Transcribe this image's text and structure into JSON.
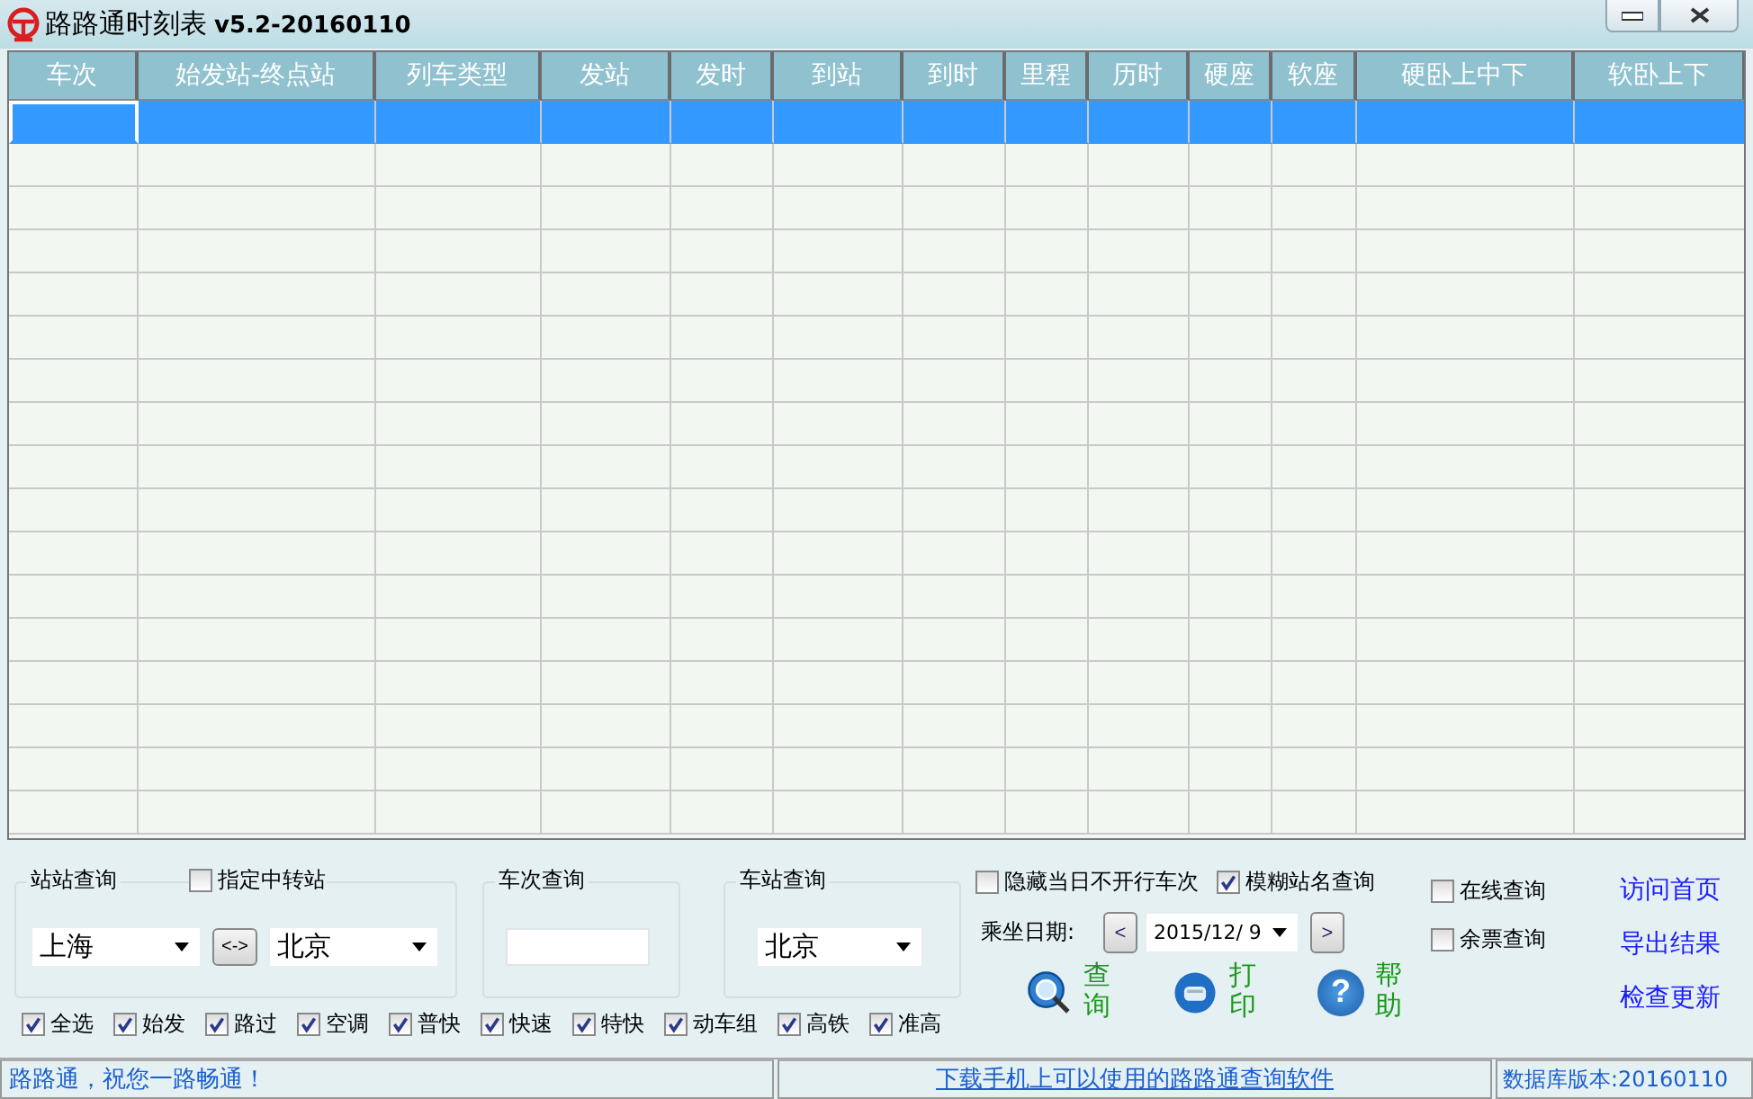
{
  "window": {
    "title": "路路通时刻表",
    "version": "v5.2-20160110"
  },
  "table": {
    "columns": [
      "车次",
      "始发站-终点站",
      "列车类型",
      "发站",
      "发时",
      "到站",
      "到时",
      "里程",
      "历时",
      "硬座",
      "软座",
      "硬卧上中下",
      "软卧上下"
    ],
    "rows": [
      {
        "selected": true
      },
      {
        "selected": false
      },
      {
        "selected": false
      },
      {
        "selected": false
      },
      {
        "selected": false
      },
      {
        "selected": false
      },
      {
        "selected": false
      },
      {
        "selected": false
      },
      {
        "selected": false
      },
      {
        "selected": false
      },
      {
        "selected": false
      },
      {
        "selected": false
      },
      {
        "selected": false
      },
      {
        "selected": false
      },
      {
        "selected": false
      },
      {
        "selected": false
      },
      {
        "selected": false
      }
    ]
  },
  "station_query": {
    "label": "站站查询",
    "transfer": {
      "label": "指定中转站",
      "checked": false
    },
    "from": "上海",
    "swap": "<->",
    "to": "北京"
  },
  "train_query": {
    "label": "车次查询"
  },
  "station_lookup": {
    "label": "车站查询",
    "value": "北京"
  },
  "filters": [
    {
      "label": "全选",
      "checked": true
    },
    {
      "label": "始发",
      "checked": true
    },
    {
      "label": "路过",
      "checked": true
    },
    {
      "label": "空调",
      "checked": true
    },
    {
      "label": "普快",
      "checked": true
    },
    {
      "label": "快速",
      "checked": true
    },
    {
      "label": "特快",
      "checked": true
    },
    {
      "label": "动车组",
      "checked": true
    },
    {
      "label": "高铁",
      "checked": true
    },
    {
      "label": "准高",
      "checked": true
    }
  ],
  "options": [
    {
      "label": "隐藏当日不开行车次",
      "checked": false
    },
    {
      "label": "模糊站名查询",
      "checked": true
    }
  ],
  "date": {
    "label": "乘坐日期:",
    "prev": "<",
    "value": "2015/12/ 9",
    "next": ">"
  },
  "actions": [
    {
      "kind": "search",
      "label": "查询"
    },
    {
      "kind": "print",
      "label": "打印"
    },
    {
      "kind": "help",
      "label": "帮助",
      "glyph": "?"
    }
  ],
  "online": [
    {
      "label": "在线查询",
      "checked": false
    },
    {
      "label": "余票查询",
      "checked": false
    }
  ],
  "links": [
    "访问首页",
    "导出结果",
    "检查更新"
  ],
  "status_bar": {
    "message": "路路通，祝您一路畅通！",
    "link": "下载手机上可以使用的路路通查询软件",
    "db_version": "数据库版本:20160110"
  }
}
